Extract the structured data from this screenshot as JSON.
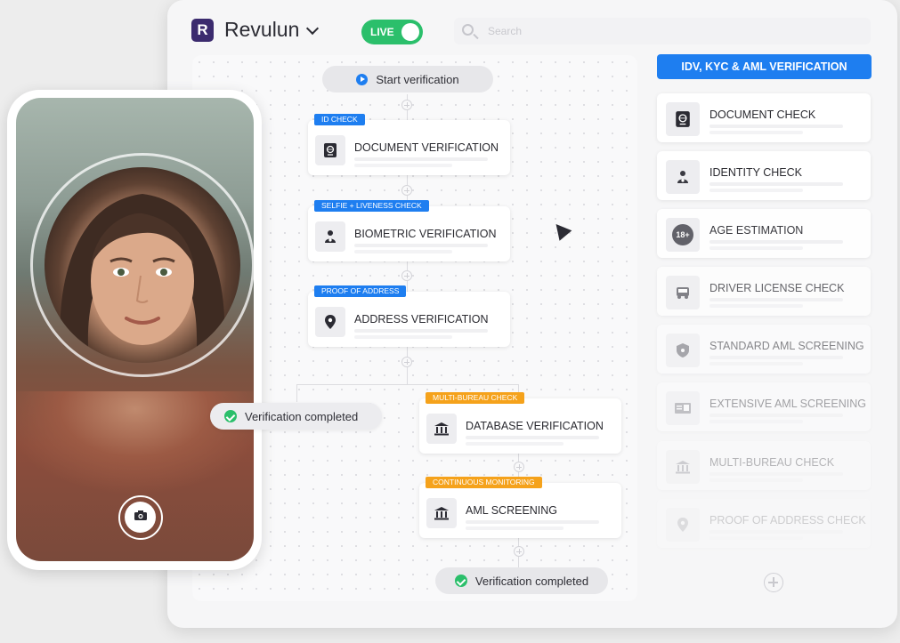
{
  "app": {
    "logo_letter": "R",
    "name": "Revulun",
    "live_label": "LIVE"
  },
  "search": {
    "placeholder": "Search"
  },
  "flow": {
    "start_label": "Start verification",
    "end_label": "Verification completed",
    "nodes": [
      {
        "tag": "ID CHECK",
        "title": "DOCUMENT VERIFICATION",
        "icon": "passport-icon",
        "tag_color": "#1e7ef0"
      },
      {
        "tag": "SELFIE + LIVENESS CHECK",
        "title": "BIOMETRIC VERIFICATION",
        "icon": "person-icon",
        "tag_color": "#1e7ef0"
      },
      {
        "tag": "PROOF OF ADDRESS",
        "title": "ADDRESS VERIFICATION",
        "icon": "location-pin-icon",
        "tag_color": "#1e7ef0"
      },
      {
        "tag": "MULTI-BUREAU CHECK",
        "title": "DATABASE VERIFICATION",
        "icon": "bank-icon",
        "tag_color": "#f5a21b"
      },
      {
        "tag": "CONTINUOUS MONITORING",
        "title": "AML SCREENING",
        "icon": "bank-icon",
        "tag_color": "#f5a21b"
      }
    ]
  },
  "panel": {
    "header": "IDV, KYC & AML VERIFICATION",
    "items": [
      {
        "label": "DOCUMENT CHECK",
        "icon": "passport-icon"
      },
      {
        "label": "IDENTITY CHECK",
        "icon": "person-icon"
      },
      {
        "label": "AGE ESTIMATION",
        "icon": "age-18-icon",
        "icon_text": "18+"
      },
      {
        "label": "DRIVER LICENSE CHECK",
        "icon": "car-icon"
      },
      {
        "label": "STANDARD AML SCREENING",
        "icon": "shield-icon"
      },
      {
        "label": "EXTENSIVE AML SCREENING",
        "icon": "id-card-icon"
      },
      {
        "label": "MULTI-BUREAU CHECK",
        "icon": "bank-icon"
      },
      {
        "label": "PROOF OF ADDRESS CHECK",
        "icon": "location-pin-icon"
      }
    ]
  },
  "phone": {
    "toast_label": "Verification completed"
  },
  "colors": {
    "accent_blue": "#1e7ef0",
    "accent_orange": "#f5a21b",
    "live_green": "#2bbf6b",
    "brand_purple": "#3b2b6e"
  }
}
